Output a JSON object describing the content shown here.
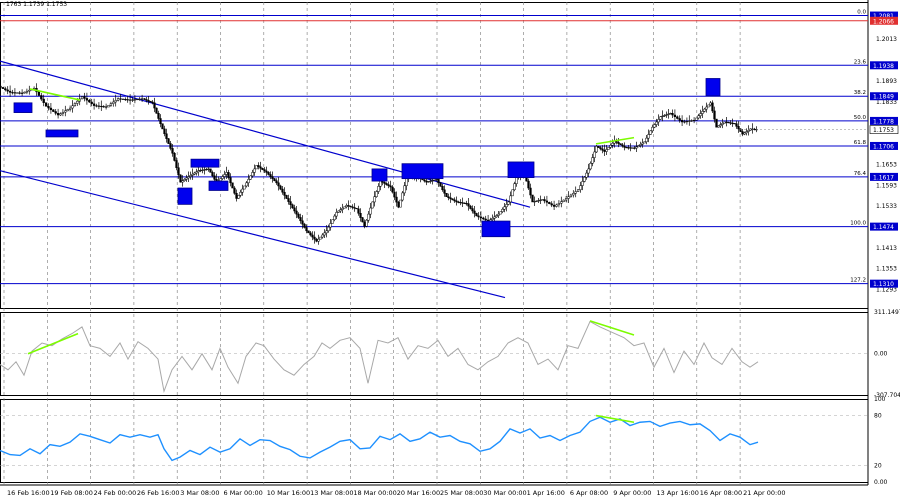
{
  "header": {
    "ohlc": "1763 1.1739 1.1753"
  },
  "chart_data": [
    {
      "type": "line",
      "panel": "price",
      "ylim": [
        1.124,
        1.212
      ],
      "price_ticks": [
        "1.2013",
        "1.1893",
        "1.1833",
        "1.1653",
        "1.1593",
        "1.1533",
        "1.1413",
        "1.1353",
        "1.1293"
      ],
      "highlighted_prices": [
        {
          "label": "1.2081",
          "kind": "level"
        },
        {
          "label": "1.2066",
          "kind": "red"
        },
        {
          "label": "1.1938",
          "kind": "level"
        },
        {
          "label": "1.1849",
          "kind": "level"
        },
        {
          "label": "1.1778",
          "kind": "level"
        },
        {
          "label": "1.1753",
          "kind": "current"
        },
        {
          "label": "1.1706",
          "kind": "level"
        },
        {
          "label": "1.1617",
          "kind": "level"
        },
        {
          "label": "1.1474",
          "kind": "level"
        },
        {
          "label": "1.1310",
          "kind": "level"
        }
      ],
      "fib_levels": [
        {
          "label": "0.0",
          "price": 1.2081
        },
        {
          "label": "23.6",
          "price": 1.1938
        },
        {
          "label": "38.2",
          "price": 1.1849
        },
        {
          "label": "50.0",
          "price": 1.1778
        },
        {
          "label": "61.8",
          "price": 1.1706
        },
        {
          "label": "76.4",
          "price": 1.1617
        },
        {
          "label": "100.0",
          "price": 1.1474
        },
        {
          "label": "127.2",
          "price": 1.131
        }
      ],
      "red_level": 1.2066,
      "time_labels": [
        "16 Feb 16:00",
        "19 Feb 08:00",
        "24 Feb 00:00",
        "26 Feb 16:00",
        "3 Mar 08:00",
        "6 Mar 00:00",
        "10 Mar 16:00",
        "13 Mar 08:00",
        "18 Mar 00:00",
        "20 Mar 16:00",
        "25 Mar 08:00",
        "30 Mar 00:00",
        "1 Apr 16:00",
        "6 Apr 08:00",
        "9 Apr 00:00",
        "13 Apr 16:00",
        "16 Apr 08:00",
        "21 Apr 00:00"
      ],
      "price_path": [
        [
          0,
          1.1878
        ],
        [
          12,
          1.186
        ],
        [
          24,
          1.1858
        ],
        [
          36,
          1.1872
        ],
        [
          48,
          1.182
        ],
        [
          60,
          1.1795
        ],
        [
          72,
          1.1815
        ],
        [
          84,
          1.1848
        ],
        [
          96,
          1.1822
        ],
        [
          108,
          1.1818
        ],
        [
          120,
          1.1842
        ],
        [
          132,
          1.1838
        ],
        [
          144,
          1.1842
        ],
        [
          154,
          1.183
        ],
        [
          164,
          1.1755
        ],
        [
          174,
          1.1685
        ],
        [
          182,
          1.1602
        ],
        [
          190,
          1.1618
        ],
        [
          200,
          1.1635
        ],
        [
          210,
          1.164
        ],
        [
          218,
          1.16
        ],
        [
          228,
          1.163
        ],
        [
          238,
          1.1555
        ],
        [
          248,
          1.16
        ],
        [
          258,
          1.165
        ],
        [
          268,
          1.163
        ],
        [
          278,
          1.16
        ],
        [
          288,
          1.1555
        ],
        [
          298,
          1.151
        ],
        [
          308,
          1.1462
        ],
        [
          318,
          1.1432
        ],
        [
          328,
          1.1462
        ],
        [
          338,
          1.1515
        ],
        [
          348,
          1.1535
        ],
        [
          358,
          1.1525
        ],
        [
          366,
          1.1475
        ],
        [
          374,
          1.1545
        ],
        [
          382,
          1.1605
        ],
        [
          392,
          1.1588
        ],
        [
          400,
          1.153
        ],
        [
          408,
          1.1612
        ],
        [
          418,
          1.1618
        ],
        [
          428,
          1.1602
        ],
        [
          438,
          1.161
        ],
        [
          448,
          1.156
        ],
        [
          458,
          1.1545
        ],
        [
          468,
          1.154
        ],
        [
          478,
          1.1505
        ],
        [
          490,
          1.149
        ],
        [
          500,
          1.151
        ],
        [
          510,
          1.1545
        ],
        [
          518,
          1.1615
        ],
        [
          526,
          1.1625
        ],
        [
          534,
          1.1545
        ],
        [
          544,
          1.1552
        ],
        [
          556,
          1.1532
        ],
        [
          568,
          1.1555
        ],
        [
          580,
          1.158
        ],
        [
          590,
          1.164
        ],
        [
          598,
          1.1705
        ],
        [
          606,
          1.169
        ],
        [
          616,
          1.172
        ],
        [
          626,
          1.1702
        ],
        [
          636,
          1.17
        ],
        [
          646,
          1.1718
        ],
        [
          654,
          1.176
        ],
        [
          662,
          1.179
        ],
        [
          672,
          1.18
        ],
        [
          684,
          1.1775
        ],
        [
          696,
          1.178
        ],
        [
          706,
          1.1812
        ],
        [
          712,
          1.183
        ],
        [
          718,
          1.176
        ],
        [
          726,
          1.1775
        ],
        [
          736,
          1.177
        ],
        [
          744,
          1.174
        ],
        [
          752,
          1.1755
        ],
        [
          758,
          1.1753
        ]
      ],
      "channel_lines": [
        {
          "p1": [
            0,
            1.195
          ],
          "p2": [
            530,
            1.153
          ]
        },
        {
          "p1": [
            0,
            1.1635
          ],
          "p2": [
            505,
            1.127
          ]
        }
      ],
      "divergence_lines": [
        {
          "p1": [
            30,
            1.187
          ],
          "p2": [
            80,
            1.1838
          ]
        },
        {
          "p1": [
            596,
            1.1712
          ],
          "p2": [
            634,
            1.173
          ]
        }
      ],
      "zones": [
        {
          "x": [
            14,
            32
          ],
          "top": 1.183,
          "bottom": 1.1802
        },
        {
          "x": [
            46,
            78
          ],
          "top": 1.1752,
          "bottom": 1.1732
        },
        {
          "x": [
            178,
            192
          ],
          "top": 1.1585,
          "bottom": 1.1538
        },
        {
          "x": [
            191,
            219
          ],
          "top": 1.1668,
          "bottom": 1.1645
        },
        {
          "x": [
            209,
            228
          ],
          "top": 1.1605,
          "bottom": 1.1578
        },
        {
          "x": [
            372,
            387
          ],
          "top": 1.164,
          "bottom": 1.1605
        },
        {
          "x": [
            402,
            443
          ],
          "top": 1.1655,
          "bottom": 1.1612
        },
        {
          "x": [
            482,
            510
          ],
          "top": 1.149,
          "bottom": 1.1445
        },
        {
          "x": [
            508,
            534
          ],
          "top": 1.166,
          "bottom": 1.1615
        },
        {
          "x": [
            706,
            720
          ],
          "top": 1.19,
          "bottom": 1.185
        }
      ]
    },
    {
      "type": "line",
      "panel": "cci",
      "ylim": [
        -307.7,
        311.15
      ],
      "ticks": [
        {
          "label": "311.1497",
          "value": 311.15
        },
        {
          "label": "0.00",
          "value": 0
        },
        {
          "label": "-307.704",
          "value": -307.7
        }
      ],
      "values": [
        [
          0,
          -80
        ],
        [
          8,
          -120
        ],
        [
          16,
          -60
        ],
        [
          24,
          -160
        ],
        [
          32,
          20
        ],
        [
          42,
          80
        ],
        [
          52,
          60
        ],
        [
          62,
          110
        ],
        [
          72,
          150
        ],
        [
          82,
          200
        ],
        [
          90,
          60
        ],
        [
          100,
          40
        ],
        [
          110,
          -20
        ],
        [
          120,
          80
        ],
        [
          128,
          -40
        ],
        [
          138,
          90
        ],
        [
          148,
          40
        ],
        [
          158,
          -40
        ],
        [
          164,
          -280
        ],
        [
          172,
          -120
        ],
        [
          182,
          -20
        ],
        [
          192,
          -120
        ],
        [
          202,
          0
        ],
        [
          212,
          -120
        ],
        [
          220,
          40
        ],
        [
          228,
          -100
        ],
        [
          238,
          -220
        ],
        [
          246,
          -20
        ],
        [
          256,
          80
        ],
        [
          264,
          60
        ],
        [
          274,
          -40
        ],
        [
          284,
          -120
        ],
        [
          294,
          -160
        ],
        [
          304,
          -80
        ],
        [
          314,
          -20
        ],
        [
          322,
          80
        ],
        [
          330,
          40
        ],
        [
          340,
          100
        ],
        [
          350,
          120
        ],
        [
          360,
          40
        ],
        [
          368,
          -220
        ],
        [
          378,
          100
        ],
        [
          388,
          80
        ],
        [
          398,
          120
        ],
        [
          408,
          -40
        ],
        [
          418,
          60
        ],
        [
          428,
          40
        ],
        [
          438,
          100
        ],
        [
          448,
          -20
        ],
        [
          458,
          40
        ],
        [
          468,
          -80
        ],
        [
          478,
          -120
        ],
        [
          488,
          -60
        ],
        [
          498,
          -20
        ],
        [
          508,
          80
        ],
        [
          518,
          120
        ],
        [
          528,
          80
        ],
        [
          538,
          -80
        ],
        [
          548,
          -40
        ],
        [
          558,
          -120
        ],
        [
          568,
          60
        ],
        [
          578,
          40
        ],
        [
          590,
          240
        ],
        [
          600,
          200
        ],
        [
          612,
          160
        ],
        [
          624,
          120
        ],
        [
          634,
          60
        ],
        [
          644,
          80
        ],
        [
          654,
          -100
        ],
        [
          664,
          40
        ],
        [
          674,
          -140
        ],
        [
          684,
          20
        ],
        [
          694,
          -80
        ],
        [
          704,
          80
        ],
        [
          712,
          -30
        ],
        [
          722,
          -80
        ],
        [
          732,
          40
        ],
        [
          742,
          -60
        ],
        [
          750,
          -100
        ],
        [
          758,
          -60
        ]
      ],
      "divergence": [
        [
          28,
          0
        ],
        [
          78,
          150
        ],
        [
          590,
          245
        ],
        [
          634,
          140
        ]
      ],
      "color": "#a8a8a8"
    },
    {
      "type": "line",
      "panel": "rsi",
      "ylim": [
        0,
        100
      ],
      "ticks": [
        {
          "label": "100",
          "value": 100
        },
        {
          "label": "80",
          "value": 80
        },
        {
          "label": "20",
          "value": 20
        },
        {
          "label": "0.00",
          "value": 0
        }
      ],
      "values": [
        [
          0,
          38
        ],
        [
          10,
          33
        ],
        [
          20,
          32
        ],
        [
          30,
          40
        ],
        [
          40,
          34
        ],
        [
          50,
          45
        ],
        [
          60,
          43
        ],
        [
          70,
          48
        ],
        [
          80,
          58
        ],
        [
          90,
          55
        ],
        [
          100,
          51
        ],
        [
          110,
          47
        ],
        [
          120,
          57
        ],
        [
          130,
          54
        ],
        [
          140,
          57
        ],
        [
          150,
          54
        ],
        [
          158,
          57
        ],
        [
          164,
          40
        ],
        [
          172,
          26
        ],
        [
          180,
          30
        ],
        [
          190,
          38
        ],
        [
          200,
          33
        ],
        [
          210,
          42
        ],
        [
          220,
          36
        ],
        [
          230,
          40
        ],
        [
          240,
          52
        ],
        [
          250,
          44
        ],
        [
          260,
          51
        ],
        [
          270,
          50
        ],
        [
          280,
          43
        ],
        [
          290,
          39
        ],
        [
          300,
          31
        ],
        [
          310,
          29
        ],
        [
          320,
          36
        ],
        [
          330,
          42
        ],
        [
          340,
          49
        ],
        [
          350,
          51
        ],
        [
          360,
          40
        ],
        [
          370,
          41
        ],
        [
          380,
          55
        ],
        [
          390,
          51
        ],
        [
          400,
          58
        ],
        [
          410,
          49
        ],
        [
          420,
          52
        ],
        [
          430,
          60
        ],
        [
          440,
          54
        ],
        [
          450,
          56
        ],
        [
          460,
          49
        ],
        [
          470,
          46
        ],
        [
          480,
          37
        ],
        [
          490,
          40
        ],
        [
          500,
          49
        ],
        [
          510,
          64
        ],
        [
          520,
          59
        ],
        [
          530,
          64
        ],
        [
          540,
          53
        ],
        [
          550,
          56
        ],
        [
          560,
          50
        ],
        [
          570,
          56
        ],
        [
          580,
          60
        ],
        [
          590,
          73
        ],
        [
          600,
          78
        ],
        [
          610,
          72
        ],
        [
          620,
          76
        ],
        [
          630,
          68
        ],
        [
          640,
          72
        ],
        [
          650,
          73
        ],
        [
          660,
          67
        ],
        [
          670,
          71
        ],
        [
          680,
          73
        ],
        [
          690,
          69
        ],
        [
          700,
          70
        ],
        [
          710,
          62
        ],
        [
          720,
          50
        ],
        [
          730,
          58
        ],
        [
          740,
          54
        ],
        [
          750,
          45
        ],
        [
          758,
          48
        ]
      ],
      "divergence": [
        [
          596,
          80
        ],
        [
          634,
          72
        ]
      ],
      "color": "#1e90ff"
    }
  ]
}
